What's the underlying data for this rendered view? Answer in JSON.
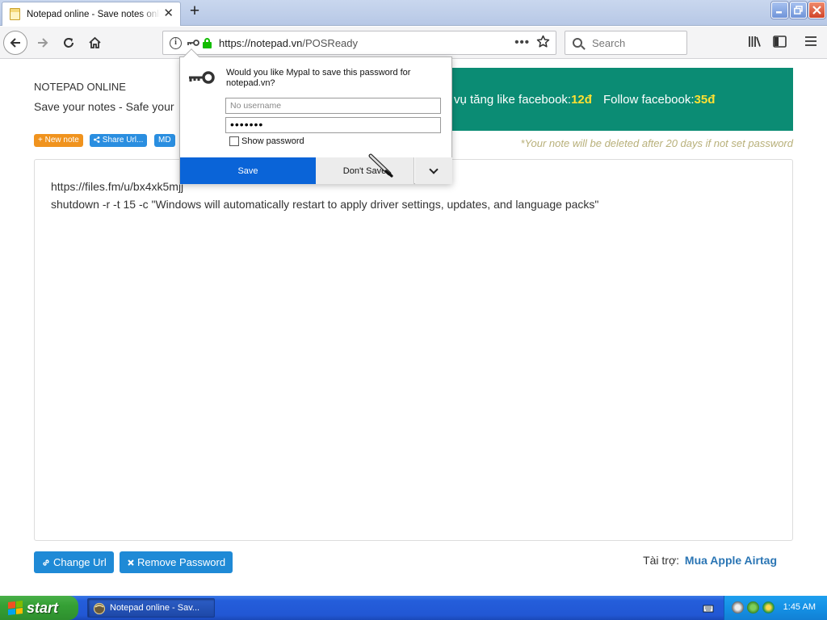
{
  "browser": {
    "tab_title": "Notepad online - Save notes online",
    "tab_close": "✕",
    "new_tab": "+",
    "url_host": "https://notepad.vn",
    "url_path": "/POSReady",
    "url_more": "•••",
    "search_placeholder": "Search"
  },
  "page": {
    "app_name": "NOTEPAD ONLINE",
    "tagline": "Save your notes - Safe your",
    "banner_text_1": "vụ tăng like facebook: ",
    "banner_price_1": "12đ",
    "banner_text_2": "Follow facebook: ",
    "banner_price_2": "35đ",
    "new_note": "+ New note",
    "share_url": "Share Url...",
    "md": "MD",
    "warning": "*Your note will be deleted after 20 days if not set password",
    "note_lines": [
      "https://files.fm/u/bx4xk5mjj",
      "shutdown -r -t 15 -c \"Windows will automatically restart to apply driver settings, updates, and language packs\""
    ],
    "change_url": "Change Url",
    "remove_password": "Remove Password",
    "sponsor_label": "Tài trợ:",
    "sponsor_link": "Mua Apple Airtag"
  },
  "password_popup": {
    "message": "Would you like Mypal to save this password for notepad.vn?",
    "username_placeholder": "No username",
    "password_mask": "•••••••",
    "show_password": "Show password",
    "save": "Save",
    "dont_save": "Don't Save"
  },
  "taskbar": {
    "start": "start",
    "task": "Notepad online - Sav...",
    "clock": "1:45 AM"
  },
  "colors": {
    "banner_bg": "#0b8c74",
    "banner_price": "#ffe032",
    "save_button": "#0a64d8",
    "primary_button": "#1f8ad6",
    "new_note_pill": "#f0931e",
    "secure_lock": "#12bc00"
  }
}
